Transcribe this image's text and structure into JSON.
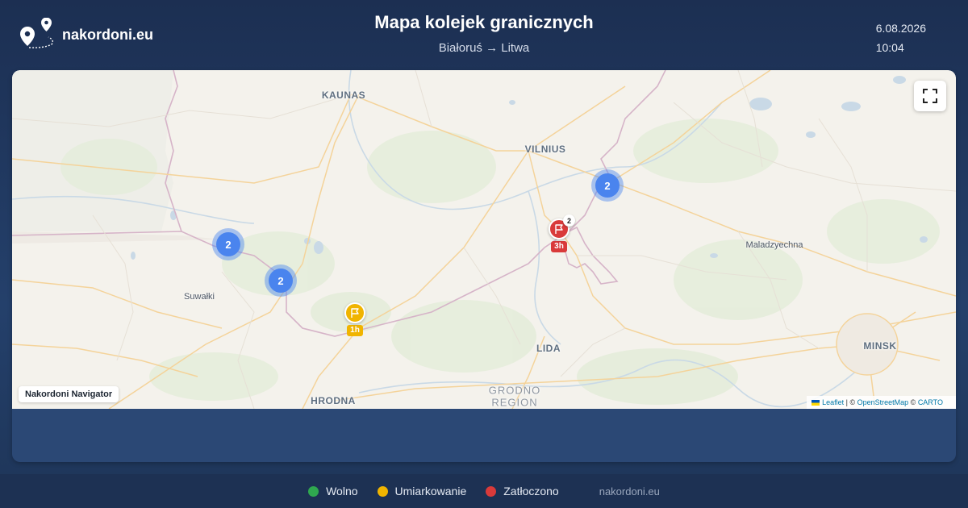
{
  "header": {
    "site": "nakordoni.eu",
    "title": "Mapa kolejek granicznych",
    "route": "Białoruś → Litwa",
    "date": "6.08.2026",
    "time": "10:04"
  },
  "map": {
    "cities": [
      {
        "name": "KAUNAS",
        "style": "major"
      },
      {
        "name": "VILNIUS",
        "style": "major"
      },
      {
        "name": "Maladzyechna",
        "style": "small"
      },
      {
        "name": "Suwałki",
        "style": "small"
      },
      {
        "name": "LIDA",
        "style": "major"
      },
      {
        "name": "MINSK",
        "style": "major"
      },
      {
        "name": "HRODNA",
        "style": "major"
      },
      {
        "name": "GRODNO",
        "style": "region"
      },
      {
        "name": "REGION",
        "style": "region"
      }
    ],
    "clusters": [
      {
        "count": "2",
        "color": "#4a84ee"
      },
      {
        "count": "2",
        "color": "#4a84ee"
      },
      {
        "count": "2",
        "color": "#4a84ee"
      }
    ],
    "crossings": [
      {
        "status": "Zatłoczono",
        "color": "#d93a3a",
        "wait": "3h",
        "count": "2",
        "icon": "flag-icon"
      },
      {
        "status": "Umiarkowanie",
        "color": "#f0b400",
        "wait": "1h",
        "icon": "flag-icon"
      }
    ],
    "nav_label": "Nakordoni Navigator",
    "attribution": {
      "leaflet": "Leaflet",
      "sep1": " | © ",
      "osm": "OpenStreetMap",
      "sep2": " © ",
      "carto": "CARTO"
    }
  },
  "legend": [
    {
      "label": "Wolno",
      "color": "#2fa84f"
    },
    {
      "label": "Umiarkowanie",
      "color": "#f0b400"
    },
    {
      "label": "Zatłoczono",
      "color": "#d93a3a"
    }
  ],
  "footer_site": "nakordoni.eu"
}
